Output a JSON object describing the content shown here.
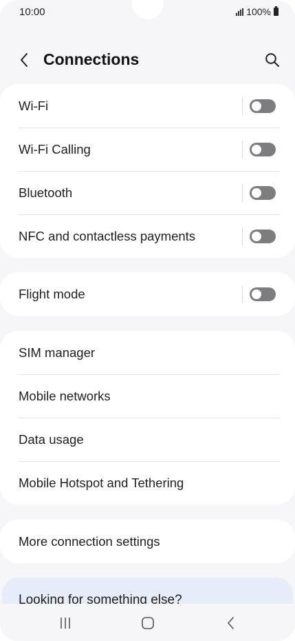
{
  "status_bar": {
    "time": "10:00",
    "battery": "100%"
  },
  "header": {
    "title": "Connections",
    "back_icon": "chevron-left-icon",
    "search_icon": "search-icon"
  },
  "groups": [
    {
      "items": [
        {
          "label": "Wi-Fi",
          "toggle": false
        },
        {
          "label": "Wi-Fi Calling",
          "toggle": false
        },
        {
          "label": "Bluetooth",
          "toggle": false
        },
        {
          "label": "NFC and contactless payments",
          "toggle": false
        }
      ]
    },
    {
      "items": [
        {
          "label": "Flight mode",
          "toggle": false
        }
      ]
    },
    {
      "items": [
        {
          "label": "SIM manager"
        },
        {
          "label": "Mobile networks"
        },
        {
          "label": "Data usage"
        },
        {
          "label": "Mobile Hotspot and Tethering"
        }
      ]
    },
    {
      "items": [
        {
          "label": "More connection settings"
        }
      ]
    }
  ],
  "suggestion": {
    "text": "Looking for something else?"
  },
  "nav_bar": {
    "recents_icon": "recents-icon",
    "home_icon": "home-icon",
    "back_icon": "back-icon"
  },
  "colors": {
    "background": "#f6f6f8",
    "card": "#ffffff",
    "toggle_off": "#7d7d80",
    "suggestion_bg": "#e6ecf8"
  }
}
